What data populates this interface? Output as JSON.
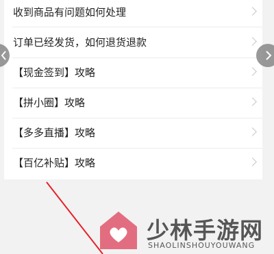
{
  "faq": {
    "items": [
      {
        "label": "收到商品有问题如何处理"
      },
      {
        "label": "订单已经发货，如何退货退款"
      },
      {
        "label": "【现金签到】攻略"
      },
      {
        "label": "【拼小圈】攻略"
      },
      {
        "label": "【多多直播】攻略"
      },
      {
        "label": "【百亿补贴】攻略"
      }
    ]
  },
  "icons": {
    "row_chevron": "chevron-right-icon",
    "nav_prev": "chevron-left-icon",
    "nav_next": "chevron-right-icon"
  },
  "watermark": {
    "title": "少林手游网",
    "subtitle": "SHAOLINSHOUYOUWANG"
  },
  "colors": {
    "background": "#f2f2f2",
    "card": "#ffffff",
    "annotation_arrow": "#e8202a",
    "logo": "#e0566c"
  }
}
